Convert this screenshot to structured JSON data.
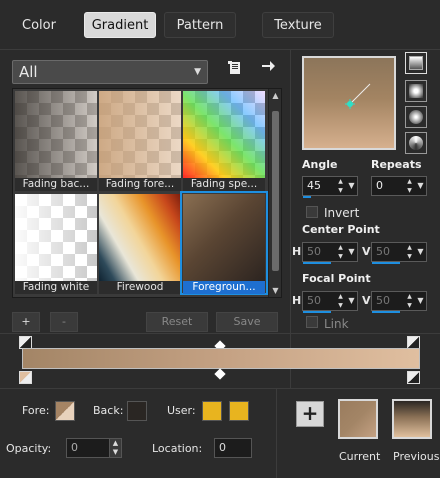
{
  "tabs": [
    {
      "label": "Color"
    },
    {
      "label": "Gradient"
    },
    {
      "label": "Pattern"
    },
    {
      "label": "Texture"
    }
  ],
  "category": {
    "value": "All"
  },
  "toolbar": {
    "save_list_icon": "document-save-icon",
    "arrow_icon": "arrow-right-icon"
  },
  "gradients": [
    {
      "label": "Fading bac..."
    },
    {
      "label": "Fading fore..."
    },
    {
      "label": "Fading spe..."
    },
    {
      "label": "Fading white"
    },
    {
      "label": "Firewood"
    },
    {
      "label": "Foregroun..."
    }
  ],
  "buttons": {
    "add": "+",
    "remove": "-",
    "reset": "Reset",
    "save": "Save"
  },
  "right": {
    "angle_label": "Angle",
    "angle": "45",
    "repeats_label": "Repeats",
    "repeats": "0",
    "invert_label": "Invert",
    "center_label": "Center Point",
    "focal_label": "Focal Point",
    "h_label": "H",
    "v_label": "V",
    "center_h": "50",
    "center_v": "50",
    "focal_h": "50",
    "focal_v": "50",
    "link_label": "Link"
  },
  "bottom": {
    "fore_label": "Fore:",
    "back_label": "Back:",
    "user_label": "User:",
    "opacity_label": "Opacity:",
    "opacity": "0",
    "location_label": "Location:",
    "location": "0",
    "current_label": "Current",
    "previous_label": "Previous"
  },
  "colors": {
    "foreground": "#a58464",
    "background": "#2a2623",
    "user1": "#e8b41f",
    "user2": "#e8b41f",
    "accent": "#1e8fe0",
    "gradient_start": "#a38566",
    "gradient_end": "#e0bfa0"
  }
}
